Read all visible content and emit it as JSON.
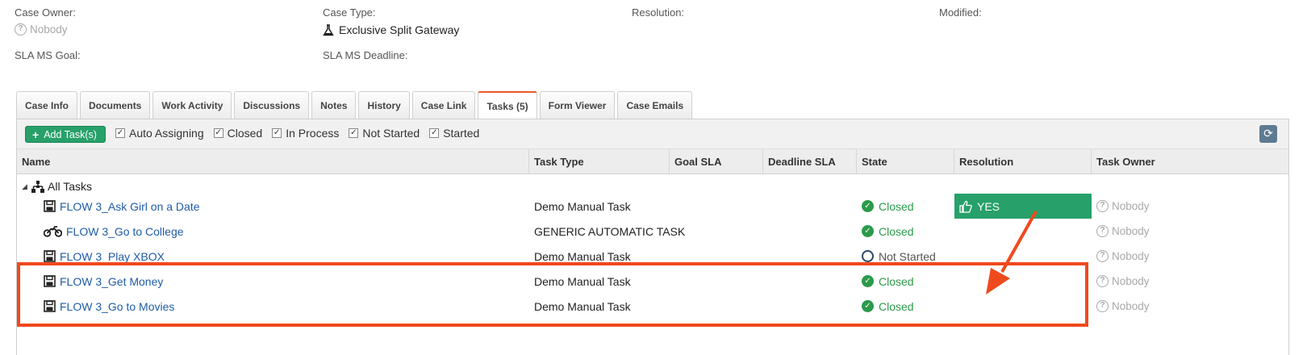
{
  "meta": {
    "case_owner_label": "Case Owner:",
    "case_owner_value": "Nobody",
    "case_type_label": "Case Type:",
    "case_type_value": "Exclusive Split Gateway",
    "resolution_label": "Resolution:",
    "modified_label": "Modified:",
    "sla_goal_label": "SLA MS Goal:",
    "sla_deadline_label": "SLA MS Deadline:"
  },
  "tabs": [
    {
      "label": "Case Info"
    },
    {
      "label": "Documents"
    },
    {
      "label": "Work Activity"
    },
    {
      "label": "Discussions"
    },
    {
      "label": "Notes"
    },
    {
      "label": "History"
    },
    {
      "label": "Case Link"
    },
    {
      "label": "Tasks (5)",
      "active": true
    },
    {
      "label": "Form Viewer"
    },
    {
      "label": "Case Emails"
    }
  ],
  "toolbar": {
    "add_label": "Add Task(s)",
    "filters": [
      "Auto Assigning",
      "Closed",
      "In Process",
      "Not Started",
      "Started"
    ]
  },
  "columns": [
    "Name",
    "Task Type",
    "Goal SLA",
    "Deadline SLA",
    "State",
    "Resolution",
    "Task Owner"
  ],
  "tree_root": "All Tasks",
  "rows": [
    {
      "name": "FLOW 3_Ask Girl on a Date",
      "icon": "save-icon",
      "type": "Demo Manual Task",
      "state": "Closed",
      "resolution": "YES",
      "owner": "Nobody"
    },
    {
      "name": "FLOW 3_Go to College",
      "icon": "motorcycle-icon",
      "type": "GENERIC AUTOMATIC TASK",
      "state": "Closed",
      "resolution": "",
      "owner": "Nobody"
    },
    {
      "name": "FLOW 3_Play XBOX",
      "icon": "save-icon",
      "type": "Demo Manual Task",
      "state": "Not Started",
      "resolution": "",
      "owner": "Nobody"
    },
    {
      "name": "FLOW 3_Get Money",
      "icon": "save-icon",
      "type": "Demo Manual Task",
      "state": "Closed",
      "resolution": "",
      "owner": "Nobody"
    },
    {
      "name": "FLOW 3_Go to Movies",
      "icon": "save-icon",
      "type": "Demo Manual Task",
      "state": "Closed",
      "resolution": "",
      "owner": "Nobody"
    }
  ],
  "colors": {
    "accent_green": "#27a06a",
    "link_blue": "#1f5ca8",
    "highlight_orange": "#f0491e",
    "state_green": "#2b9a4a"
  }
}
